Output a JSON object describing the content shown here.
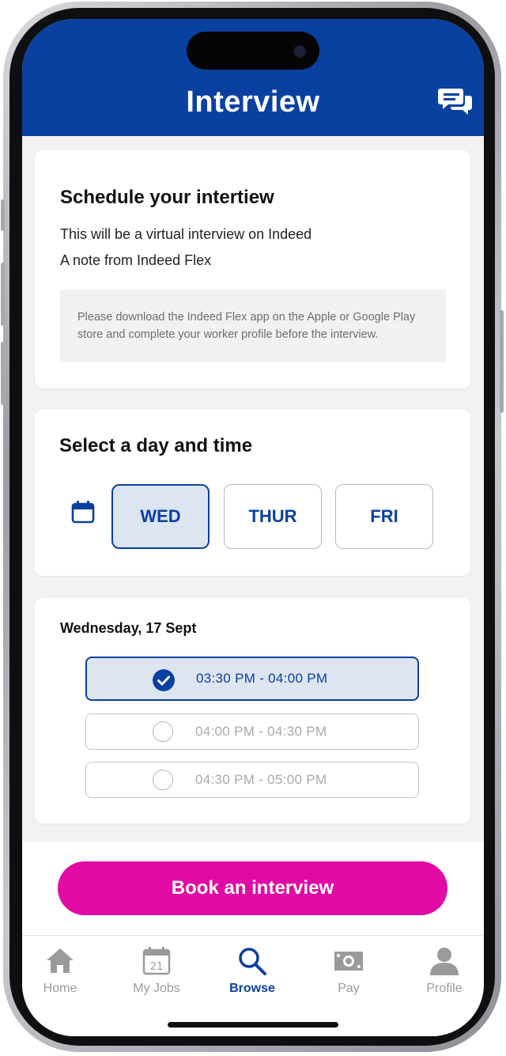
{
  "header": {
    "title": "Interview"
  },
  "schedule": {
    "heading": "Schedule your intertiew",
    "line1": "This will be a virtual interview on Indeed",
    "line2": "A note from Indeed Flex",
    "note": "Please download the Indeed Flex app on the Apple or Google Play store and complete your worker profile before the interview."
  },
  "day_select": {
    "heading": "Select a day and time",
    "days": [
      {
        "label": "WED",
        "selected": true
      },
      {
        "label": "THUR",
        "selected": false
      },
      {
        "label": "FRI",
        "selected": false
      }
    ]
  },
  "time_slots": {
    "date": "Wednesday, 17 Sept",
    "slots": [
      {
        "label": "03:30 PM - 04:00 PM",
        "selected": true
      },
      {
        "label": "04:00 PM - 04:30 PM",
        "selected": false
      },
      {
        "label": "04:30 PM - 05:00 PM",
        "selected": false
      }
    ]
  },
  "book_button": {
    "label": "Book an interview"
  },
  "tabbar": {
    "items": [
      {
        "label": "Home",
        "icon": "home-icon",
        "active": false
      },
      {
        "label": "My Jobs",
        "icon": "calendar-21-icon",
        "calendar_number": "21",
        "active": false
      },
      {
        "label": "Browse",
        "icon": "search-icon",
        "active": true
      },
      {
        "label": "Pay",
        "icon": "banknote-icon",
        "active": false
      },
      {
        "label": "Profile",
        "icon": "person-icon",
        "active": false
      }
    ]
  },
  "colors": {
    "brand_blue": "#0a40a0",
    "selected_bg": "#dde5f1",
    "cta_pink": "#e10aa5",
    "inactive_gray": "#9a9a9a"
  }
}
